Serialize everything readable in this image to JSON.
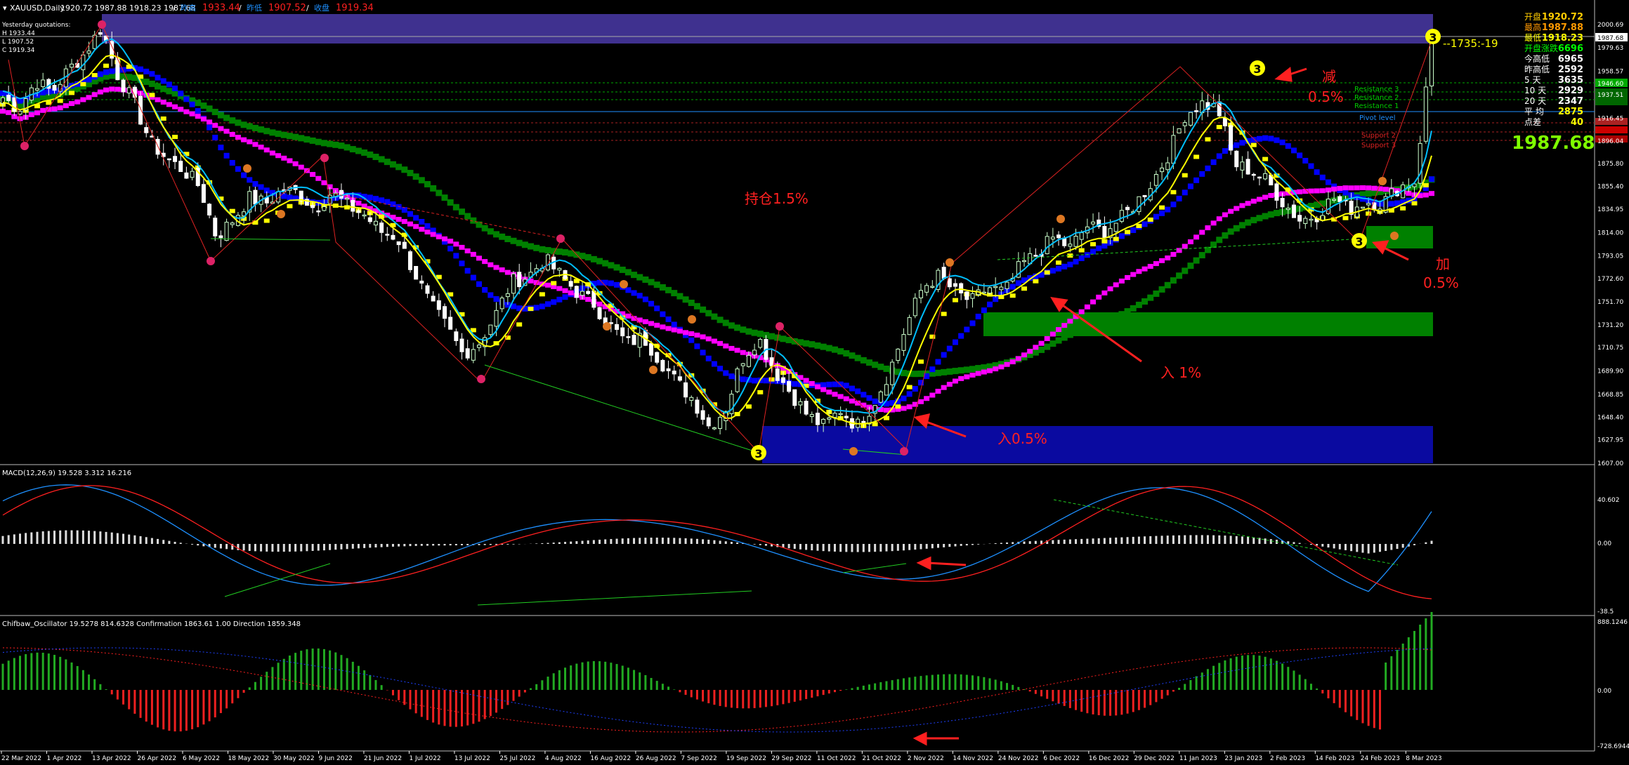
{
  "header": {
    "symbol": "XAUUSD,Daily",
    "ohlc": "1920.72 1987.88 1918.23 1987.68",
    "prev_high_label": "昨高",
    "prev_high": "1933.44",
    "prev_low_label": "昨低",
    "prev_low": "1907.52",
    "prev_close_label": "收盘",
    "prev_close": "1919.34"
  },
  "yesterday_box": {
    "title": "Yesterday quotations:",
    "h": "H 1933.44",
    "l": "L 1907.52",
    "c": "C 1919.34"
  },
  "info_panel": {
    "rows": [
      {
        "label": "开盘",
        "value": "1920.72",
        "color": "#ffcc00"
      },
      {
        "label": "最高",
        "value": "1987.88",
        "color": "#ff9900"
      },
      {
        "label": "最低",
        "value": "1918.23",
        "color": "#ffff00"
      },
      {
        "label": "开盘涨跌",
        "value": "6696",
        "color": "#00ff00"
      },
      {
        "label": "今高低",
        "value": "6965",
        "color": "#ffffff"
      },
      {
        "label": "昨高低",
        "value": "2592",
        "color": "#ffffff"
      },
      {
        "label": "5  天",
        "value": "3635",
        "color": "#ffffff"
      },
      {
        "label": "10 天",
        "value": "2929",
        "color": "#ffffff"
      },
      {
        "label": "20 天",
        "value": "2347",
        "color": "#ffffff"
      },
      {
        "label": "平 均",
        "value": "2875",
        "color": "#ffff00"
      },
      {
        "label": "点差",
        "value": "40",
        "color": "#ffff00"
      }
    ],
    "big_price": "1987.68"
  },
  "levels": {
    "resistance": [
      "Resistance 3",
      "Resistance 2",
      "Resistance 1"
    ],
    "pivot": "Pivot level",
    "support": [
      "Support 2",
      "Support 3"
    ]
  },
  "annotations": {
    "hold": "持仓1.5%",
    "reduce_a": "减",
    "reduce_b": "0.5%",
    "add_a": "加",
    "add_b": "0.5%",
    "enter1": "入 1%",
    "enter05": "入0.5%",
    "countdown": "--1735:-19",
    "wave_marker": "3"
  },
  "macd_title": "MACD(12,26,9) 19.528 3.312 16.216",
  "osc_title": "Chifbaw_Oscillator 19.5278 814.6328  Confirmation 1863.61 1.00  Direction 1859.348",
  "colors": {
    "bull": "#ccffcc",
    "bear": "#ffffff",
    "yellow": "#ffff00",
    "blue": "#0000ff",
    "magenta": "#ff00ff",
    "green_ma": "#008000",
    "cyan": "#00bfff",
    "red": "#ff2020"
  },
  "chart_data": {
    "type": "candlestick",
    "symbol": "XAUUSD",
    "timeframe": "Daily",
    "ylim": [
      1607.0,
      2010.0
    ],
    "y_ticks": [
      "2000.69",
      "1979.63",
      "1958.57",
      "1937.51",
      "1916.45",
      "1896.04",
      "1875.80",
      "1855.40",
      "1834.95",
      "1814.00",
      "1793.05",
      "1772.60",
      "1751.70",
      "1731.20",
      "1710.75",
      "1689.90",
      "1668.85",
      "1648.40",
      "1627.95",
      "1607.00"
    ],
    "x_labels": [
      "22 Mar 2022",
      "1 Apr 2022",
      "13 Apr 2022",
      "26 Apr 2022",
      "6 May 2022",
      "18 May 2022",
      "30 May 2022",
      "9 Jun 2022",
      "21 Jun 2022",
      "1 Jul 2022",
      "13 Jul 2022",
      "25 Jul 2022",
      "4 Aug 2022",
      "16 Aug 2022",
      "26 Aug 2022",
      "7 Sep 2022",
      "19 Sep 2022",
      "29 Sep 2022",
      "11 Oct 2022",
      "21 Oct 2022",
      "2 Nov 2022",
      "14 Nov 2022",
      "24 Nov 2022",
      "6 Dec 2022",
      "16 Dec 2022",
      "29 Dec 2022",
      "11 Jan 2023",
      "23 Jan 2023",
      "2 Feb 2023",
      "14 Feb 2023",
      "24 Feb 2023",
      "8 Mar 2023"
    ],
    "close_path": [
      1935,
      1925,
      1950,
      1940,
      1960,
      1975,
      1998,
      1955,
      1930,
      1895,
      1880,
      1870,
      1855,
      1810,
      1825,
      1845,
      1840,
      1852,
      1850,
      1835,
      1850,
      1838,
      1830,
      1815,
      1810,
      1780,
      1750,
      1730,
      1705,
      1715,
      1740,
      1770,
      1775,
      1790,
      1775,
      1760,
      1750,
      1730,
      1715,
      1720,
      1700,
      1680,
      1665,
      1640,
      1655,
      1700,
      1720,
      1690,
      1670,
      1650,
      1640,
      1655,
      1640,
      1660,
      1690,
      1730,
      1765,
      1775,
      1760,
      1752,
      1765,
      1760,
      1785,
      1795,
      1810,
      1800,
      1820,
      1815,
      1825,
      1840,
      1860,
      1885,
      1920,
      1930,
      1925,
      1875,
      1870,
      1860,
      1840,
      1825,
      1830,
      1845,
      1835,
      1842,
      1840,
      1855,
      1860,
      1985
    ],
    "price_labels": {
      "last": "1987.68",
      "resistance_tag": "1946.60"
    },
    "macd": {
      "params": "12,26,9",
      "values": [
        19.528,
        3.312,
        16.216
      ],
      "ylim": [
        -38.5,
        40.602
      ],
      "ticks": [
        "40.602",
        "0.00",
        "-38.5"
      ]
    },
    "oscillator": {
      "name": "Chifbaw_Oscillator",
      "values": [
        19.5278,
        814.6328
      ],
      "confirmation": [
        1863.61,
        1.0
      ],
      "direction": 1859.348,
      "ticks": [
        "888.1246",
        "0.00",
        "-728.6944"
      ]
    }
  }
}
